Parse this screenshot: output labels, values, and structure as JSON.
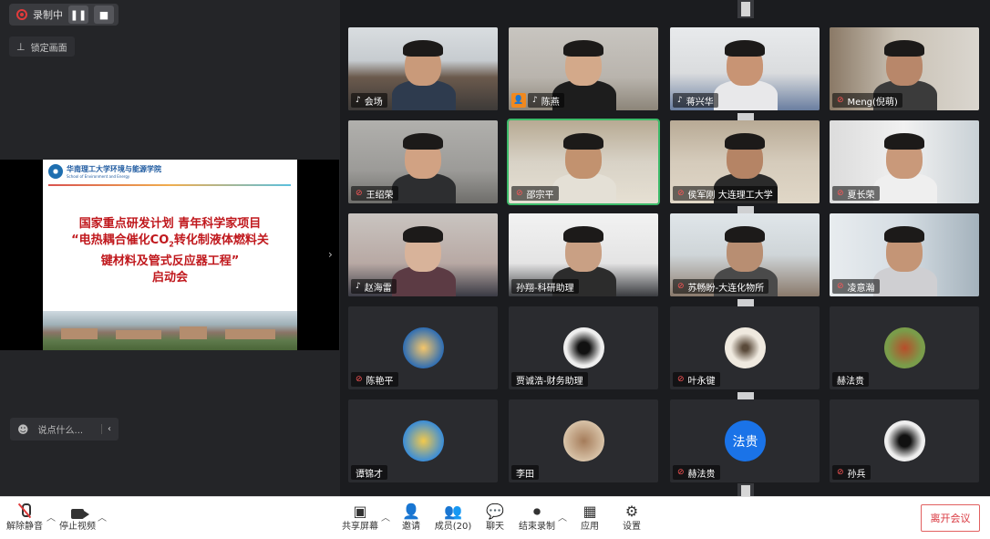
{
  "recording": {
    "status": "录制中",
    "pause_glyph": "❚❚",
    "stop_glyph": "■"
  },
  "lock_view": {
    "label": "锁定画面"
  },
  "slide": {
    "school_cn": "华南理工大学环境与能源学院",
    "school_en": "School of Environment and Energy",
    "title_line1": "国家重点研发计划 青年科学家项目",
    "title_line2a": "“电热耦合催化CO",
    "title_line2sub": "2",
    "title_line2b": "转化制液体燃料关",
    "title_line3": "键材料及管式反应器工程”",
    "title_line4": "启动会"
  },
  "chat": {
    "placeholder": "说点什么...",
    "emoji_glyph": "☻",
    "chev_glyph": "‹"
  },
  "side_arrow": "›",
  "participants": [
    {
      "name": "会场",
      "mic": "on"
    },
    {
      "name": "陈燕",
      "mic": "on",
      "host": true
    },
    {
      "name": "蒋兴华",
      "mic": "on"
    },
    {
      "name": "Meng(倪萌)",
      "mic": "off"
    },
    {
      "name": "王绍荣",
      "mic": "off"
    },
    {
      "name": "邵宗平",
      "mic": "off"
    },
    {
      "name": "侯军刚 大连理工大学",
      "mic": "off"
    },
    {
      "name": "夏长荣",
      "mic": "off"
    },
    {
      "name": "赵海雷",
      "mic": "on"
    },
    {
      "name": "孙翔-科研助理",
      "mic": "none"
    },
    {
      "name": "苏畅盼-大连化物所",
      "mic": "off"
    },
    {
      "name": "凌意瀚",
      "mic": "off"
    },
    {
      "name": "陈艳平",
      "mic": "off"
    },
    {
      "name": "贾诚浩-财务助理",
      "mic": "none"
    },
    {
      "name": "叶永键",
      "mic": "off"
    },
    {
      "name": "赫法贵",
      "mic": "none"
    },
    {
      "name": "谭锦才",
      "mic": "none"
    },
    {
      "name": "李田",
      "mic": "none"
    },
    {
      "name": "赫法贵",
      "mic": "off",
      "initials": "法贵"
    },
    {
      "name": "孙兵",
      "mic": "off"
    }
  ],
  "toolbar": {
    "unmute": "解除静音",
    "stop_video": "停止视频",
    "share_screen": "共享屏幕",
    "invite": "邀请",
    "members": "成员(20)",
    "chat": "聊天",
    "stop_record": "结束录制",
    "apps": "应用",
    "settings": "设置",
    "leave": "离开会议"
  },
  "colors": {
    "accent_red": "#d9363e",
    "active_speaker": "#3dbb6a",
    "avatar_blue": "#1a73e8",
    "slide_title": "#c0181d"
  }
}
